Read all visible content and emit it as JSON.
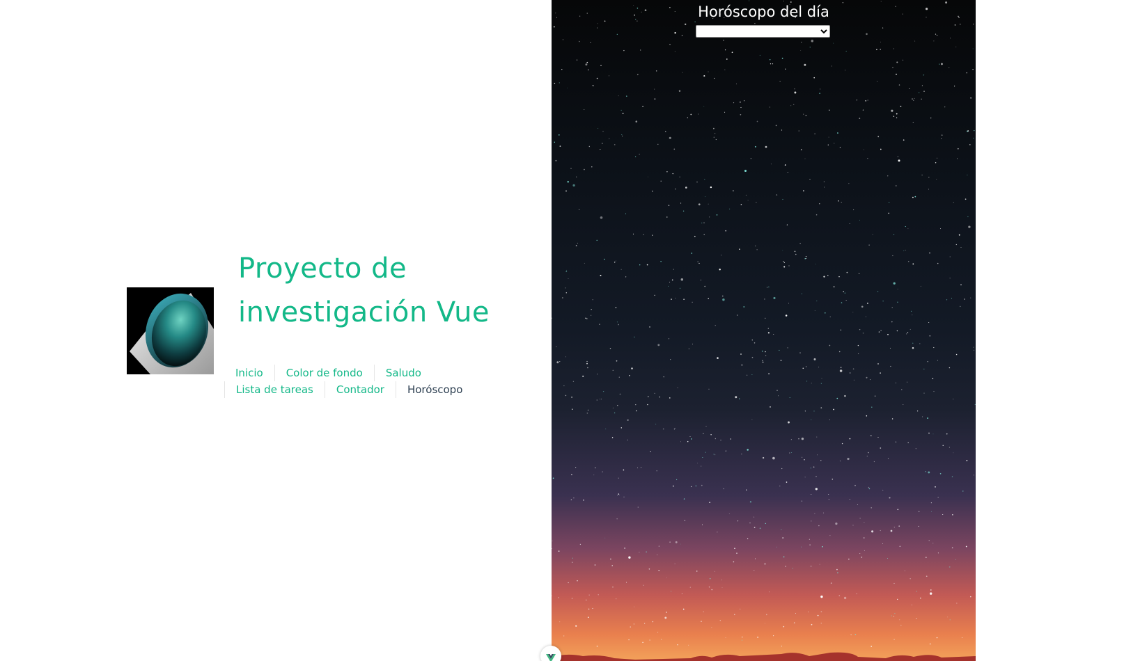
{
  "header": {
    "title": "Proyecto de investigación Vue",
    "logo_icon": "vue-project-logo-icon"
  },
  "nav": {
    "row1": [
      {
        "label": "Inicio"
      },
      {
        "label": "Color de fondo"
      },
      {
        "label": "Saludo"
      }
    ],
    "row2": [
      {
        "label": "Lista de tareas"
      },
      {
        "label": "Contador"
      },
      {
        "label": "Horóscopo",
        "active": true
      }
    ]
  },
  "horoscope": {
    "title": "Horóscopo del día",
    "select_value": "",
    "background": "starry-night-sky"
  },
  "devtools": {
    "icon": "vue-devtools-icon"
  },
  "colors": {
    "accent": "#13b888",
    "nav_active": "#2c3e50",
    "nav_divider": "#e5e5e5"
  }
}
